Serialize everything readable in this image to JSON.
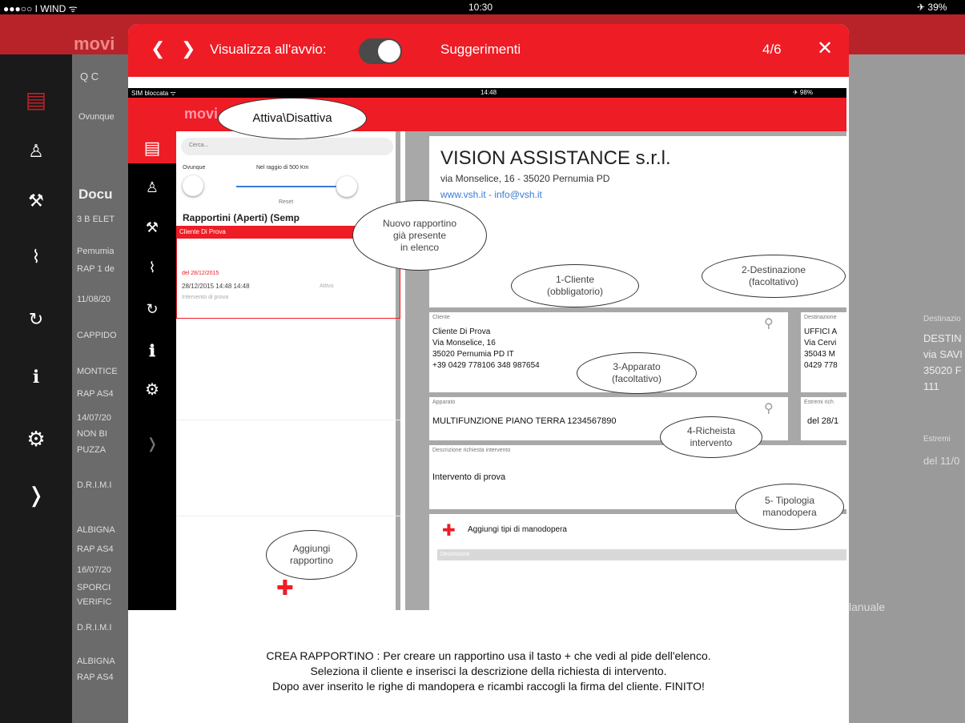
{
  "status_bar": {
    "carrier": "●●●○○ I WIND ᯤ",
    "time": "10:30",
    "battery": "✈ 39%"
  },
  "background": {
    "app_title": "movi",
    "search_placeholder": "Q C",
    "scope_label": "Ovunque",
    "section_label": "Docu",
    "rows": [
      "3 B ELET",
      "Pemumia",
      "RAP 1 de",
      "11/08/20",
      "CAPPIDO",
      "MONTICE",
      "RAP AS4",
      "14/07/20",
      "NON BI",
      "PUZZA",
      "D.R.I.M.I",
      "ALBIGNA",
      "RAP AS4",
      "16/07/20",
      "SPORCI",
      "VERIFIC",
      "D.R.I.M.I",
      "ALBIGNA",
      "RAP AS4"
    ],
    "right_panel": {
      "dest_label": "Destinazio",
      "dest_lines": [
        "DESTIN",
        "via SAVI",
        "35020 F",
        "111"
      ],
      "extremes_label": "Estremi",
      "extremes_value": "del 11/0",
      "manual": "lanuale"
    }
  },
  "modal": {
    "toolbar": {
      "prev": "❮",
      "next": "❯",
      "show_on_start_label": "Visualizza all'avvio:",
      "title": "Suggerimenti",
      "page": "4/6",
      "close": "✕"
    },
    "inner_screenshot": {
      "status": {
        "carrier": "SIM bloccata ᯤ",
        "time": "14:48",
        "battery": "✈ 98%"
      },
      "app_title": "movi",
      "search_placeholder": "Cerca...",
      "scope_label": "Ovunque",
      "radius_label": "Nel raggio di 500 Km",
      "reset_label": "Reset",
      "list_header": "Rapportini (Aperti) (Semp",
      "selected_row": "Cliente Di Prova",
      "row_detail": {
        "line1": "del 28/12/2015",
        "line2": "28/12/2015  14:48  14:48",
        "line3": "Intervento di prova",
        "status": "Attivo"
      },
      "company": {
        "name": "VISION ASSISTANCE s.r.l.",
        "address": "via Monselice, 16 - 35020 Pernumia PD",
        "web": "www.vsh.it - info@vsh.it"
      },
      "client_card": {
        "label": "Cliente",
        "lines": [
          "Cliente Di Prova",
          "Via Monselice, 16",
          "35020  Pernumia  PD  IT",
          "+39 0429 778106  348 987654"
        ]
      },
      "dest_card": {
        "label": "Destinazione",
        "lines": [
          "UFFICI A",
          "Via Cervi",
          "35043 M",
          "0429 778"
        ]
      },
      "device_card": {
        "label": "Apparato",
        "value": "MULTIFUNZIONE PIANO TERRA  1234567890"
      },
      "extremes_card": {
        "label": "Estremi rich",
        "value": "del 28/1"
      },
      "request_card": {
        "label": "Descrizione richiesta intervento",
        "value": "Intervento di prova"
      },
      "labour_card": {
        "add_label": "Aggiungi tipi di manodopera",
        "sub_label": "Descrizione"
      }
    },
    "callouts": {
      "toggle": "Attiva\\Disattiva",
      "new_report": "Nuovo rapportino\ngià presente\nin elenco",
      "client": "1-Cliente\n(obbligatorio)",
      "destination": "2-Destinazione\n(facoltativo)",
      "device": "3-Apparato\n(facoltativo)",
      "request": "4-Richeista\nintervento",
      "labour": "5- Tipologia\nmanodopera",
      "add_report": "Aggiungi\nrapportino"
    },
    "footer": [
      "CREA RAPPORTINO : Per creare un rapportino usa il tasto + che vedi al pide dell'elenco.",
      "Seleziona il cliente e inserisci la descrizione della richiesta di intervento.",
      "Dopo aver inserito le righe di mandopera e ricambi raccogli la firma del cliente. FINITO!"
    ]
  }
}
